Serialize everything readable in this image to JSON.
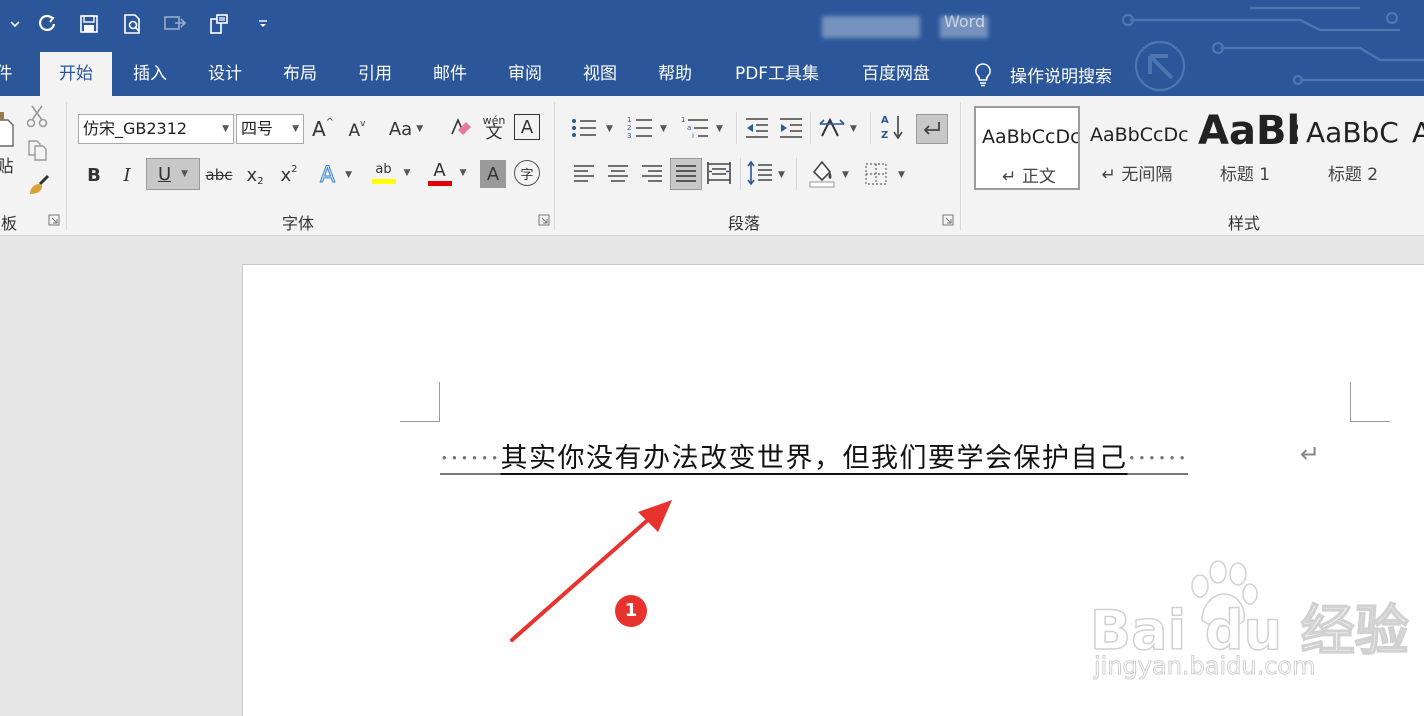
{
  "title": {
    "app_name": "Word"
  },
  "tabs": [
    {
      "label": "件"
    },
    {
      "label": "开始"
    },
    {
      "label": "插入"
    },
    {
      "label": "设计"
    },
    {
      "label": "布局"
    },
    {
      "label": "引用"
    },
    {
      "label": "邮件"
    },
    {
      "label": "审阅"
    },
    {
      "label": "视图"
    },
    {
      "label": "帮助"
    },
    {
      "label": "PDF工具集"
    },
    {
      "label": "百度网盘"
    }
  ],
  "tell_me": {
    "label": "操作说明搜索",
    "icon": "lightbulb-icon"
  },
  "ribbon": {
    "clipboard": {
      "label": "板",
      "paste_label": "贴"
    },
    "font": {
      "label": "字体",
      "font_name": "仿宋_GB2312",
      "font_size": "四号",
      "grow_glyph": "A",
      "shrink_glyph": "A",
      "case_glyph": "Aa",
      "phonetic_glyph": "wén",
      "phonetic_sub": "文",
      "border_glyph": "A",
      "bold": "B",
      "italic": "I",
      "underline": "U",
      "strike": "abc",
      "subscript": "x",
      "superscript": "x",
      "effects_glyph": "A",
      "highlight_glyph": "ab",
      "color_glyph": "A",
      "shading_glyph": "A",
      "enclose_glyph": "字",
      "highlight_color": "#ffff00",
      "font_color": "#e00000"
    },
    "paragraph": {
      "label": "段落"
    },
    "styles": {
      "label": "样式",
      "items": [
        {
          "sample": "AaBbCcDc",
          "name": "↵ 正文"
        },
        {
          "sample": "AaBbCcDc",
          "name": "↵ 无间隔"
        },
        {
          "sample": "AaBb",
          "name": "标题 1"
        },
        {
          "sample": "AaBbC",
          "name": "标题 2"
        },
        {
          "sample": "A",
          "name": ""
        }
      ]
    }
  },
  "document": {
    "lead_dots": "······",
    "sentence": "其实你没有办法改变世界，但我们要学会保护自己",
    "trail_dots": "······",
    "paragraph_mark": "↵"
  },
  "annotation": {
    "badge": "1",
    "color": "#e8322e"
  },
  "watermark": {
    "brand": "Bai du 经验",
    "url": "jingyan.baidu.com"
  },
  "colors": {
    "brand": "#2b579a",
    "ribbon": "#f3f3f3",
    "canvas": "#e6e6e6"
  }
}
